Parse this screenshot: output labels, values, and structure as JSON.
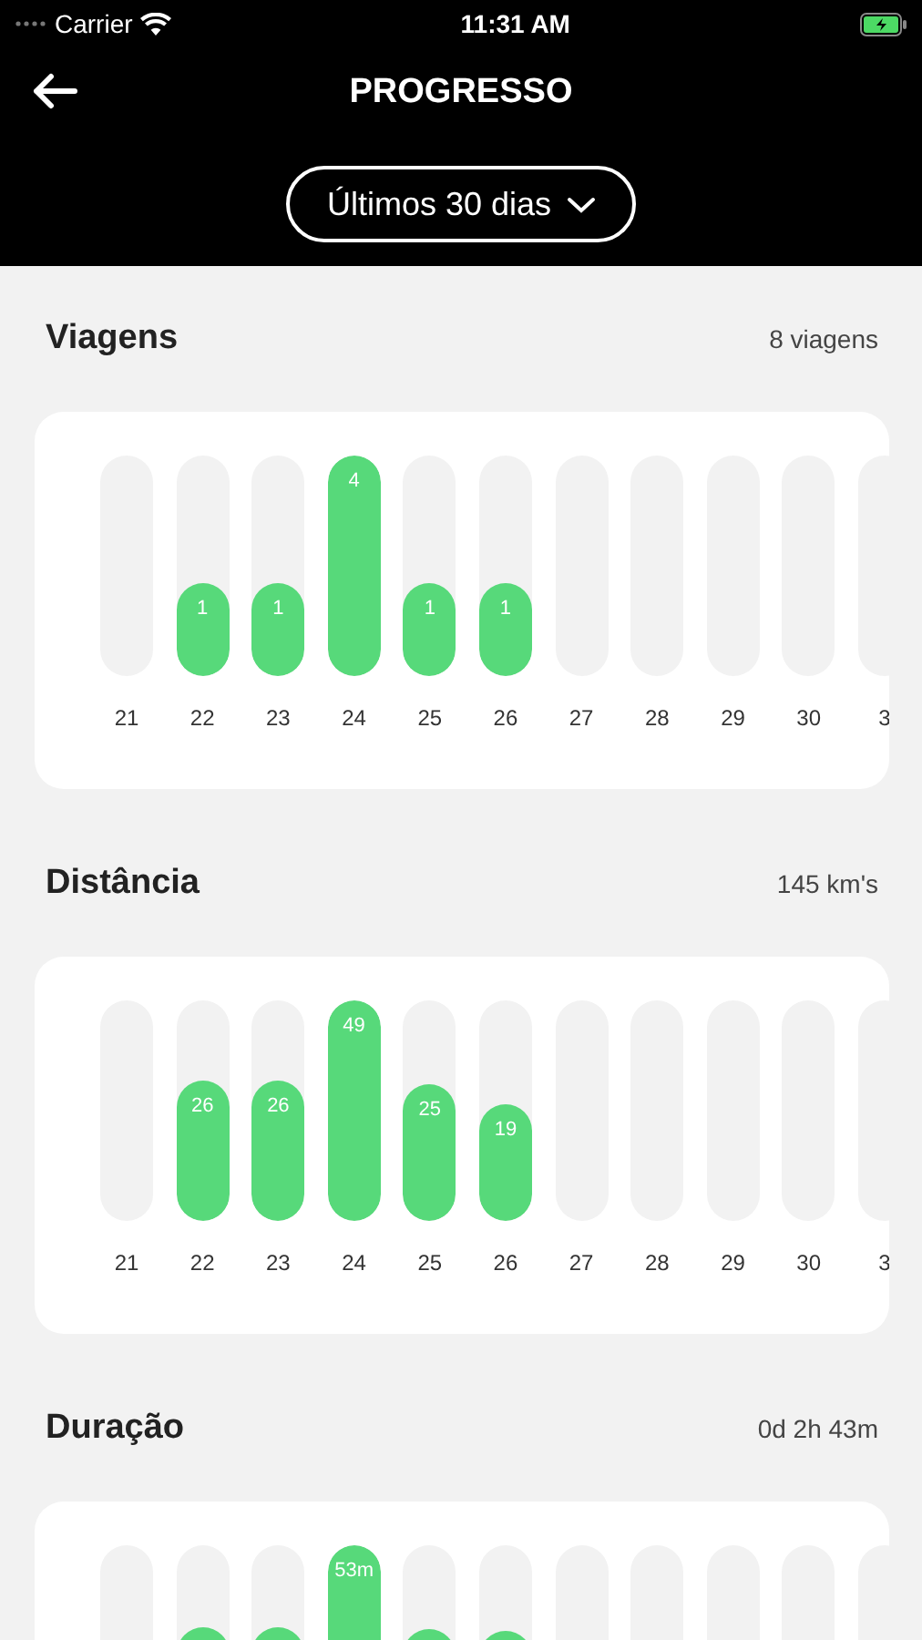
{
  "status_bar": {
    "carrier": "Carrier",
    "time": "11:31 AM"
  },
  "header": {
    "title": "PROGRESSO",
    "period": "Últimos 30 dias"
  },
  "sections": [
    {
      "title": "Viagens",
      "total": "8 viagens",
      "days": [
        "21",
        "22",
        "23",
        "24",
        "25",
        "26",
        "27",
        "28",
        "29",
        "30",
        "3"
      ],
      "bars": [
        {
          "kind": "empty"
        },
        {
          "kind": "filled",
          "level": 0.42,
          "label": "1"
        },
        {
          "kind": "filled",
          "level": 0.42,
          "label": "1"
        },
        {
          "kind": "filled",
          "level": 1,
          "label": "4"
        },
        {
          "kind": "filled",
          "level": 0.42,
          "label": "1"
        },
        {
          "kind": "filled",
          "level": 0.42,
          "label": "1"
        },
        {
          "kind": "empty"
        },
        {
          "kind": "empty"
        },
        {
          "kind": "empty"
        },
        {
          "kind": "empty"
        },
        {
          "kind": "empty"
        }
      ]
    },
    {
      "title": "Distância",
      "total": "145 km's",
      "days": [
        "21",
        "22",
        "23",
        "24",
        "25",
        "26",
        "27",
        "28",
        "29",
        "30",
        "3"
      ],
      "bars": [
        {
          "kind": "empty"
        },
        {
          "kind": "filled",
          "level": 0.64,
          "label": "26"
        },
        {
          "kind": "filled",
          "level": 0.64,
          "label": "26"
        },
        {
          "kind": "filled",
          "level": 1,
          "label": "49"
        },
        {
          "kind": "filled",
          "level": 0.62,
          "label": "25"
        },
        {
          "kind": "filled",
          "level": 0.53,
          "label": "19"
        },
        {
          "kind": "empty"
        },
        {
          "kind": "empty"
        },
        {
          "kind": "empty"
        },
        {
          "kind": "empty"
        },
        {
          "kind": "empty"
        }
      ]
    },
    {
      "title": "Duração",
      "total": "0d 2h 43m",
      "bars": [
        {
          "kind": "empty"
        },
        {
          "kind": "filled",
          "level": 0.63
        },
        {
          "kind": "filled",
          "level": 0.63
        },
        {
          "kind": "filled",
          "level": 1,
          "label": "53m"
        },
        {
          "kind": "filled",
          "level": 0.62
        },
        {
          "kind": "filled",
          "level": 0.61
        },
        {
          "kind": "empty"
        },
        {
          "kind": "empty"
        },
        {
          "kind": "empty"
        },
        {
          "kind": "empty"
        },
        {
          "kind": "empty"
        }
      ]
    }
  ]
}
